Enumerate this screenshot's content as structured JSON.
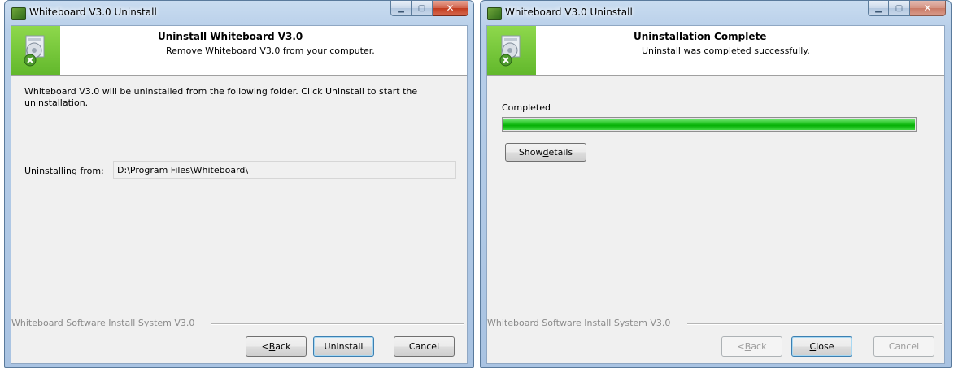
{
  "left_window": {
    "title": "Whiteboard V3.0 Uninstall",
    "header_title": "Uninstall Whiteboard V3.0",
    "header_subtitle": "Remove Whiteboard V3.0 from your computer.",
    "body_text": "Whiteboard V3.0 will be uninstalled from the following folder. Click Uninstall to start the uninstallation.",
    "from_label": "Uninstalling from:",
    "from_value": "D:\\Program Files\\Whiteboard\\",
    "branding": "Whiteboard Software Install System V3.0",
    "back_prefix": "< ",
    "back_key": "B",
    "back_rest": "ack",
    "uninstall_label": "Uninstall",
    "cancel_label": "Cancel"
  },
  "right_window": {
    "title": "Whiteboard V3.0 Uninstall",
    "header_title": "Uninstallation Complete",
    "header_subtitle": "Uninstall was completed successfully.",
    "completed_label": "Completed",
    "progress": 1.0,
    "show_details_prefix": "Show ",
    "show_details_key": "d",
    "show_details_rest": "etails",
    "branding": "Whiteboard Software Install System V3.0",
    "back_prefix": "< ",
    "back_key": "B",
    "back_rest": "ack",
    "close_key": "C",
    "close_rest": "lose",
    "cancel_label": "Cancel"
  },
  "icons": [
    "application-icon",
    "minimize-icon",
    "maximize-icon",
    "close-icon",
    "uninstall-logo-icon"
  ],
  "colors": {
    "accent_green": "#62b82c",
    "progress_green": "#06b006",
    "titlebar_blue": "#b8cfe9"
  }
}
